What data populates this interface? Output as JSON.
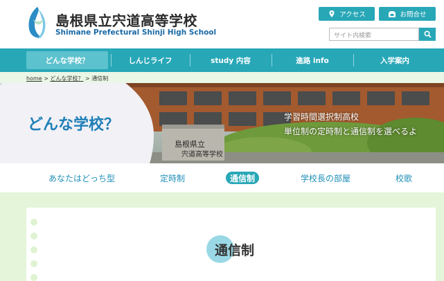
{
  "header": {
    "school_name_jp": "島根県立宍道高等学校",
    "school_name_en": "Shimane Prefectural Shinji High School",
    "access_label": "アクセス",
    "contact_label": "お問合せ",
    "search_placeholder": "サイト内検索"
  },
  "nav": {
    "items": [
      {
        "label": "どんな学校？",
        "active": true
      },
      {
        "label": "しんじライフ"
      },
      {
        "label": "study 内容"
      },
      {
        "label": "進路 info"
      },
      {
        "label": "入学案内"
      }
    ]
  },
  "breadcrumb": {
    "home": "home",
    "parent": "どんな学校？",
    "current": "通信制",
    "sep": ">"
  },
  "hero": {
    "title": "どんな学校？",
    "caption_line1": "学習時間選択制高校",
    "caption_line2": "単位制の定時制と通信制を選べるよ",
    "sign_text": "島根県立 宍道高等学校"
  },
  "subnav": {
    "items": [
      {
        "label": "あなたはどっち型"
      },
      {
        "label": "定時制"
      },
      {
        "label": "通信制",
        "active": true
      },
      {
        "label": "学校長の部屋"
      },
      {
        "label": "校歌"
      }
    ]
  },
  "section": {
    "title": "通信制"
  },
  "colors": {
    "teal": "#28a7b7",
    "nav_active": "#5cc2cd",
    "hero_title": "#1f7fb7",
    "content_bg": "#e4f5d9"
  },
  "icons": {
    "access": "map-pin-icon",
    "contact": "phone-icon",
    "search": "search-icon",
    "logo": "school-emblem-icon"
  }
}
